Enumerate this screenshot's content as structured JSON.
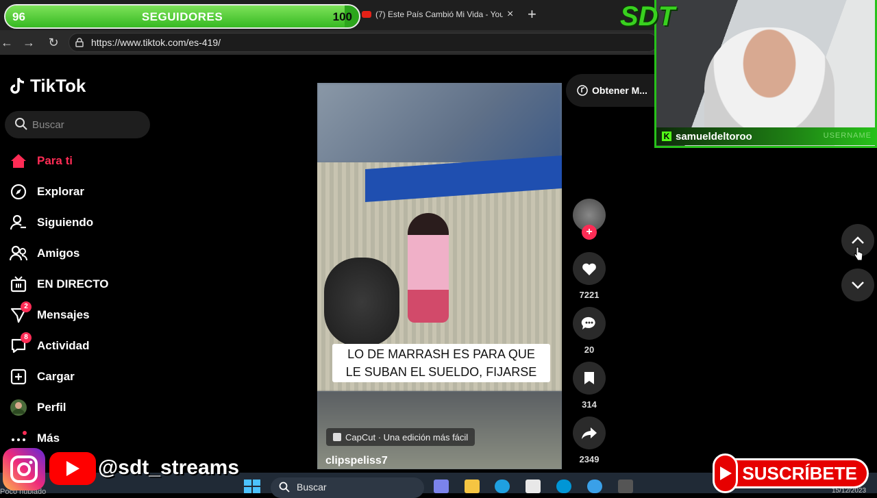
{
  "browser": {
    "url": "https://www.tiktok.com/es-419/",
    "tab2_title": "(7) Este País Cambió Mi Vida - You",
    "tab2_close": "×",
    "new_tab": "+",
    "nav_back": "←",
    "nav_forward": "→",
    "nav_reload": "↻"
  },
  "goal": {
    "current": "96",
    "target": "100",
    "label": "SEGUIDORES",
    "progress_percent": 96,
    "color": "#36b922"
  },
  "tiktok": {
    "logo": "TikTok",
    "search_placeholder": "Buscar",
    "accent": "#fe2c55",
    "nav": [
      {
        "label": "Para ti",
        "icon": "home-icon",
        "active": true
      },
      {
        "label": "Explorar",
        "icon": "compass-icon"
      },
      {
        "label": "Siguiendo",
        "icon": "following-icon"
      },
      {
        "label": "Amigos",
        "icon": "friends-icon"
      },
      {
        "label": "EN DIRECTO",
        "icon": "live-icon"
      },
      {
        "label": "Mensajes",
        "icon": "messages-icon",
        "badge": "2"
      },
      {
        "label": "Actividad",
        "icon": "activity-icon",
        "badge": "8"
      },
      {
        "label": "Cargar",
        "icon": "upload-icon"
      },
      {
        "label": "Perfil",
        "icon": "avatar"
      },
      {
        "label": "Más",
        "icon": "more-icon"
      }
    ],
    "video": {
      "caption_line1": "LO DE MARRASH ES PARA QUE",
      "caption_line2": "LE SUBAN EL SUELDO, FIJARSE",
      "capcut": "CapCut · Una edición más fácil",
      "author": "clipspeliss7",
      "obtener": "Obtener M..."
    },
    "actions": {
      "likes": "7221",
      "comments": "20",
      "saves": "314",
      "shares": "2349"
    }
  },
  "stream": {
    "logo": "SDT",
    "username": "samueldeltoroo",
    "username_tag": "USERNAME",
    "social_handle": "@sdt_streams",
    "subscribe": "SUSCRÍBETE",
    "brand_green": "#27c21a"
  },
  "taskbar": {
    "search": "Buscar",
    "left_text": "Poco nublado",
    "clock": "15/12/2023"
  }
}
